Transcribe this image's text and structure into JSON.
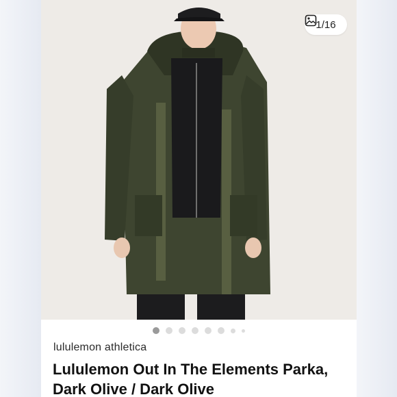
{
  "photo": {
    "counter_text": "1/16",
    "counter_icon": "image-icon",
    "alt": "Model wearing dark olive parka over black zip vest"
  },
  "carousel": {
    "total_dots": 8,
    "active_index": 0
  },
  "listing": {
    "brand": "lululemon athletica",
    "title": "Lululemon Out In The Elements Parka, Dark Olive / Dark Olive"
  },
  "colors": {
    "parka": "#3e4530",
    "vest": "#1a1a1c",
    "background": "#eeebe7"
  }
}
